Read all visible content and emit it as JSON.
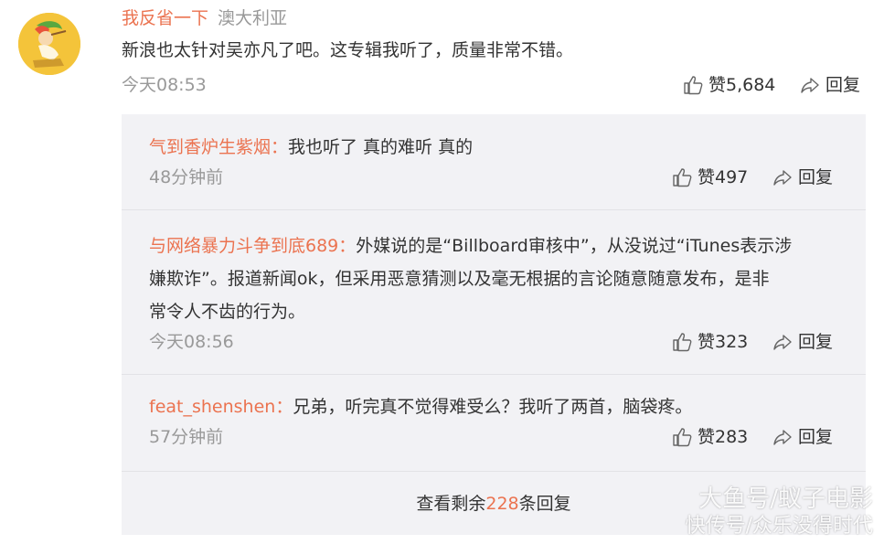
{
  "comment": {
    "username": "我反省一下",
    "location": "澳大利亚",
    "text": "新浪也太针对吴亦凡了吧。这专辑我听了，质量非常不错。",
    "time": "今天08:53",
    "like_label": "赞5,684",
    "reply_label": "回复"
  },
  "replies": [
    {
      "user": "气到香炉生紫烟：",
      "text": "我也听了 真的难听 真的",
      "time": "48分钟前",
      "like_label": "赞497",
      "reply_label": "回复"
    },
    {
      "user": "与网络暴力斗争到底689：",
      "text1": "外媒说的是“Billboard审核中”，从没说过“iTunes表示涉",
      "text2": "嫌欺诈”。报道新闻ok，但采用恶意猜测以及毫无根据的言论随意随意发布，是非",
      "text3": "常令人不齿的行为。",
      "time": "今天08:56",
      "like_label": "赞323",
      "reply_label": "回复"
    },
    {
      "user": "feat_shenshen：",
      "text": "兄弟，听完真不觉得难受么？我听了两首，脑袋疼。",
      "time": "57分钟前",
      "like_label": "赞283",
      "reply_label": "回复"
    }
  ],
  "more": {
    "prefix": "查看剩余",
    "count": "228",
    "suffix": "条回复"
  },
  "watermark": {
    "line1": "大鱼号/蚁子电影",
    "line2": "快传号/众乐没得时代"
  },
  "colors": {
    "accent": "#eb7350",
    "panel": "#f2f2f5",
    "muted": "#999999"
  }
}
